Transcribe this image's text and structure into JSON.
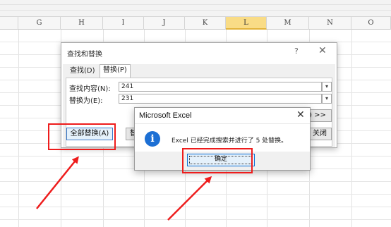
{
  "sheet": {
    "columns": [
      "G",
      "H",
      "I",
      "J",
      "K",
      "L",
      "M",
      "N",
      "O"
    ],
    "selected_column": "L"
  },
  "find_dialog": {
    "title": "查找和替换",
    "help": "?",
    "close": "✕",
    "tabs": [
      {
        "label": "查找(D)",
        "active": false
      },
      {
        "label": "替换(P)",
        "active": true
      }
    ],
    "find_label": "查找内容(N):",
    "find_value": "241",
    "replace_label": "替换为(E):",
    "replace_value": "231",
    "options_button": ") >>",
    "replace_all_button": "全部替换(A)",
    "partial_button": "替",
    "close_button_partial": "关闭"
  },
  "message_box": {
    "title": "Microsoft Excel",
    "close": "✕",
    "icon": "info-icon",
    "message": "Excel 已经完成搜索并进行了 5 处替换。",
    "ok_label": "确定"
  },
  "colors": {
    "annotation": "#ee1c1c",
    "selected_column": "#f9dc86",
    "info_icon": "#1c6fd4"
  }
}
